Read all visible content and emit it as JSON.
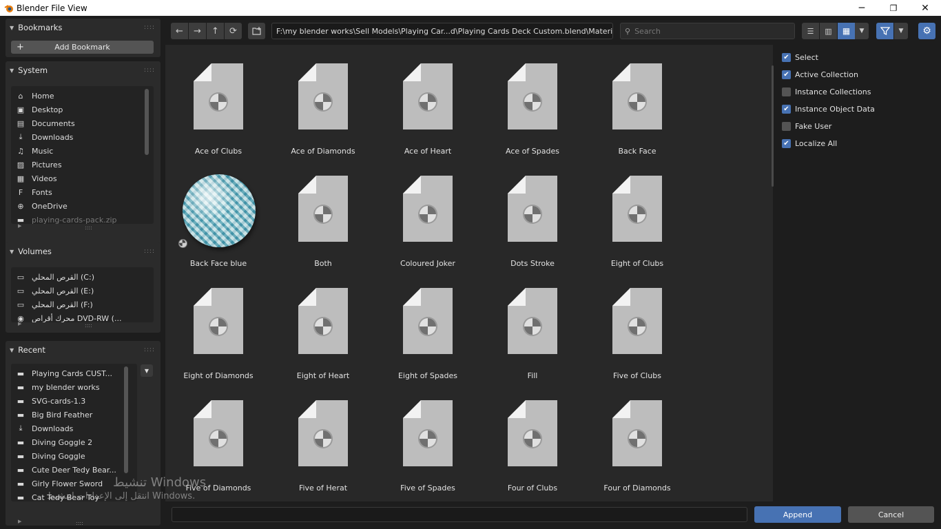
{
  "window": {
    "title": "Blender File View",
    "minimize": "─",
    "restore": "❐",
    "close": "✕"
  },
  "sidebar": {
    "bookmarks": {
      "title": "Bookmarks",
      "add_label": "Add Bookmark"
    },
    "system": {
      "title": "System",
      "items": [
        {
          "label": "Home",
          "icon": "home-icon"
        },
        {
          "label": "Desktop",
          "icon": "desktop-icon"
        },
        {
          "label": "Documents",
          "icon": "documents-icon"
        },
        {
          "label": "Downloads",
          "icon": "download-icon"
        },
        {
          "label": "Music",
          "icon": "music-icon"
        },
        {
          "label": "Pictures",
          "icon": "pictures-icon"
        },
        {
          "label": "Videos",
          "icon": "videos-icon"
        },
        {
          "label": "Fonts",
          "icon": "fonts-icon"
        },
        {
          "label": "OneDrive",
          "icon": "globe-icon"
        },
        {
          "label": "playing-cards-pack.zip",
          "icon": "folder-icon"
        }
      ]
    },
    "volumes": {
      "title": "Volumes",
      "items": [
        {
          "label": "‏القرص المحلي (C:)",
          "icon": "drive-icon"
        },
        {
          "label": "‏القرص المحلي (E:)",
          "icon": "drive-icon"
        },
        {
          "label": "‏القرص المحلي (F:)",
          "icon": "drive-icon"
        },
        {
          "label": "‏محرك أقراص DVD-RW (...",
          "icon": "disc-icon"
        }
      ]
    },
    "recent": {
      "title": "Recent",
      "items": [
        {
          "label": "Playing Cards CUST...",
          "icon": "folder-icon"
        },
        {
          "label": "my blender works",
          "icon": "folder-icon"
        },
        {
          "label": "SVG-cards-1.3",
          "icon": "folder-icon"
        },
        {
          "label": "Big Bird Feather",
          "icon": "folder-icon"
        },
        {
          "label": "Downloads",
          "icon": "download-icon"
        },
        {
          "label": "Diving Goggle 2",
          "icon": "folder-icon"
        },
        {
          "label": "Diving Goggle",
          "icon": "folder-icon"
        },
        {
          "label": "Cute Deer Tedy Bear...",
          "icon": "folder-icon"
        },
        {
          "label": "Girly Flower Sword",
          "icon": "folder-icon"
        },
        {
          "label": "Cat Tedy Bear Toy",
          "icon": "folder-icon"
        }
      ]
    }
  },
  "toolbar": {
    "path": "F:\\my blender works\\Sell Models\\Playing Car...d\\Playing Cards Deck Custom.blend\\Material\\",
    "search_placeholder": "Search"
  },
  "files": [
    {
      "name": "Ace of Clubs",
      "preview": "document"
    },
    {
      "name": "Ace of Diamonds",
      "preview": "document"
    },
    {
      "name": "Ace of Heart",
      "preview": "document"
    },
    {
      "name": "Ace of Spades",
      "preview": "document"
    },
    {
      "name": "Back Face",
      "preview": "document"
    },
    {
      "name": "Back Face blue",
      "preview": "sphere"
    },
    {
      "name": "Both",
      "preview": "document"
    },
    {
      "name": "Coloured Joker",
      "preview": "document"
    },
    {
      "name": "Dots Stroke",
      "preview": "document"
    },
    {
      "name": "Eight of Clubs",
      "preview": "document"
    },
    {
      "name": "Eight of Diamonds",
      "preview": "document"
    },
    {
      "name": "Eight of Heart",
      "preview": "document"
    },
    {
      "name": "Eight of Spades",
      "preview": "document"
    },
    {
      "name": "Fill",
      "preview": "document"
    },
    {
      "name": "Five of Clubs",
      "preview": "document"
    },
    {
      "name": "Five of Diamonds",
      "preview": "document"
    },
    {
      "name": "Five of Herat",
      "preview": "document"
    },
    {
      "name": "Five of Spades",
      "preview": "document"
    },
    {
      "name": "Four of Clubs",
      "preview": "document"
    },
    {
      "name": "Four of Diamonds",
      "preview": "document"
    }
  ],
  "options": [
    {
      "label": "Select",
      "checked": true
    },
    {
      "label": "Active Collection",
      "checked": true
    },
    {
      "label": "Instance Collections",
      "checked": false
    },
    {
      "label": "Instance Object Data",
      "checked": true
    },
    {
      "label": "Fake User",
      "checked": false
    },
    {
      "label": "Localize All",
      "checked": true
    }
  ],
  "bottom": {
    "filename": "",
    "append_label": "Append",
    "cancel_label": "Cancel"
  },
  "watermark": {
    "line1": "تنشيط Windows",
    "line2": "انتقل إلى الإعدادات لتنشيط Windows."
  },
  "colors": {
    "accent": "#4772b3",
    "background": "#1d1d1d",
    "grid_background": "#282828"
  }
}
